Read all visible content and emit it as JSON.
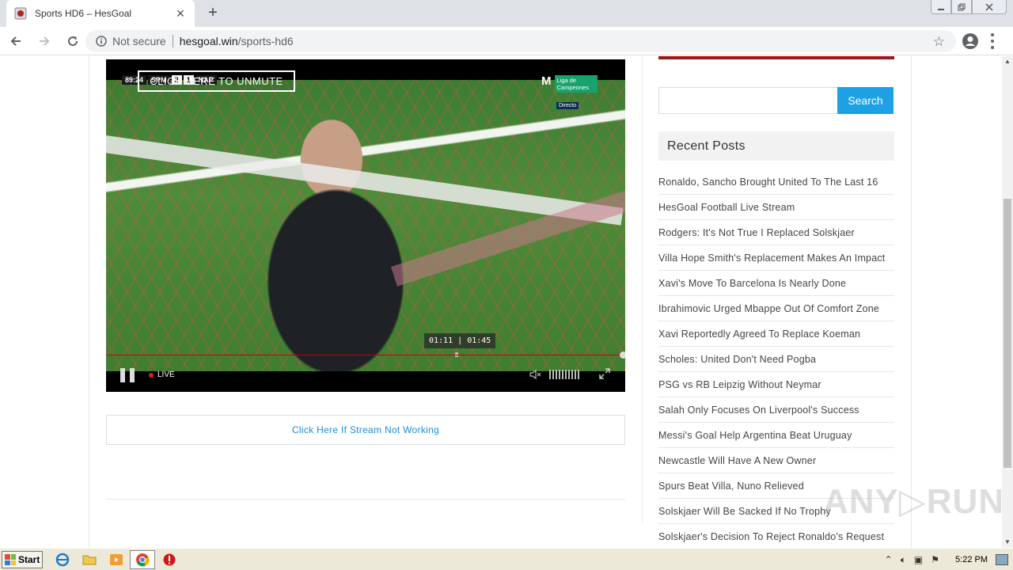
{
  "browser": {
    "tab_title": "Sports HD6 – HesGoal",
    "tab_close": "✕",
    "new_tab": "+",
    "security_label": "Not secure",
    "url_host": "hesgoal.win",
    "url_path": "/sports-hd6"
  },
  "player": {
    "scorebug": {
      "time": "89:24",
      "home": "SPM",
      "home_score": "2",
      "away_score": "1",
      "away": "NAP"
    },
    "unmute_label": "CLICK HERE TO UNMUTE",
    "broadcaster_logo": "M",
    "channel_name": "Liga de Campeones",
    "channel_status": "Directo",
    "current_time": "01:11",
    "duration": "01:45",
    "live_label": "LIVE"
  },
  "stream_link": "Click Here If Stream Not Working",
  "sidebar": {
    "search_placeholder": "",
    "search_button": "Search",
    "recent_posts_title": "Recent Posts",
    "posts": [
      "Ronaldo, Sancho Brought United To The Last 16",
      "HesGoal Football Live Stream",
      "Rodgers: It's Not True I Replaced Solskjaer",
      "Villa Hope Smith's Replacement Makes An Impact",
      "Xavi's Move To Barcelona Is Nearly Done",
      "Ibrahimovic Urged Mbappe Out Of Comfort Zone",
      "Xavi Reportedly Agreed To Replace Koeman",
      "Scholes: United Don't Need Pogba",
      "PSG vs RB Leipzig Without Neymar",
      "Salah Only Focuses On Liverpool's Success",
      "Messi's Goal Help Argentina Beat Uruguay",
      "Newcastle Will Have A New Owner",
      "Spurs Beat Villa, Nuno Relieved",
      "Solskjaer Will Be Sacked If No Trophy",
      "Solskjaer's Decision To Reject Ronaldo's Request"
    ]
  },
  "watermark": "ANY▷RUN",
  "taskbar": {
    "start_label": "Start",
    "clock": "5:22 PM"
  },
  "colors": {
    "accent": "#1ea1e4",
    "link": "#1a8fd8",
    "live_dot": "#e21b1b"
  }
}
